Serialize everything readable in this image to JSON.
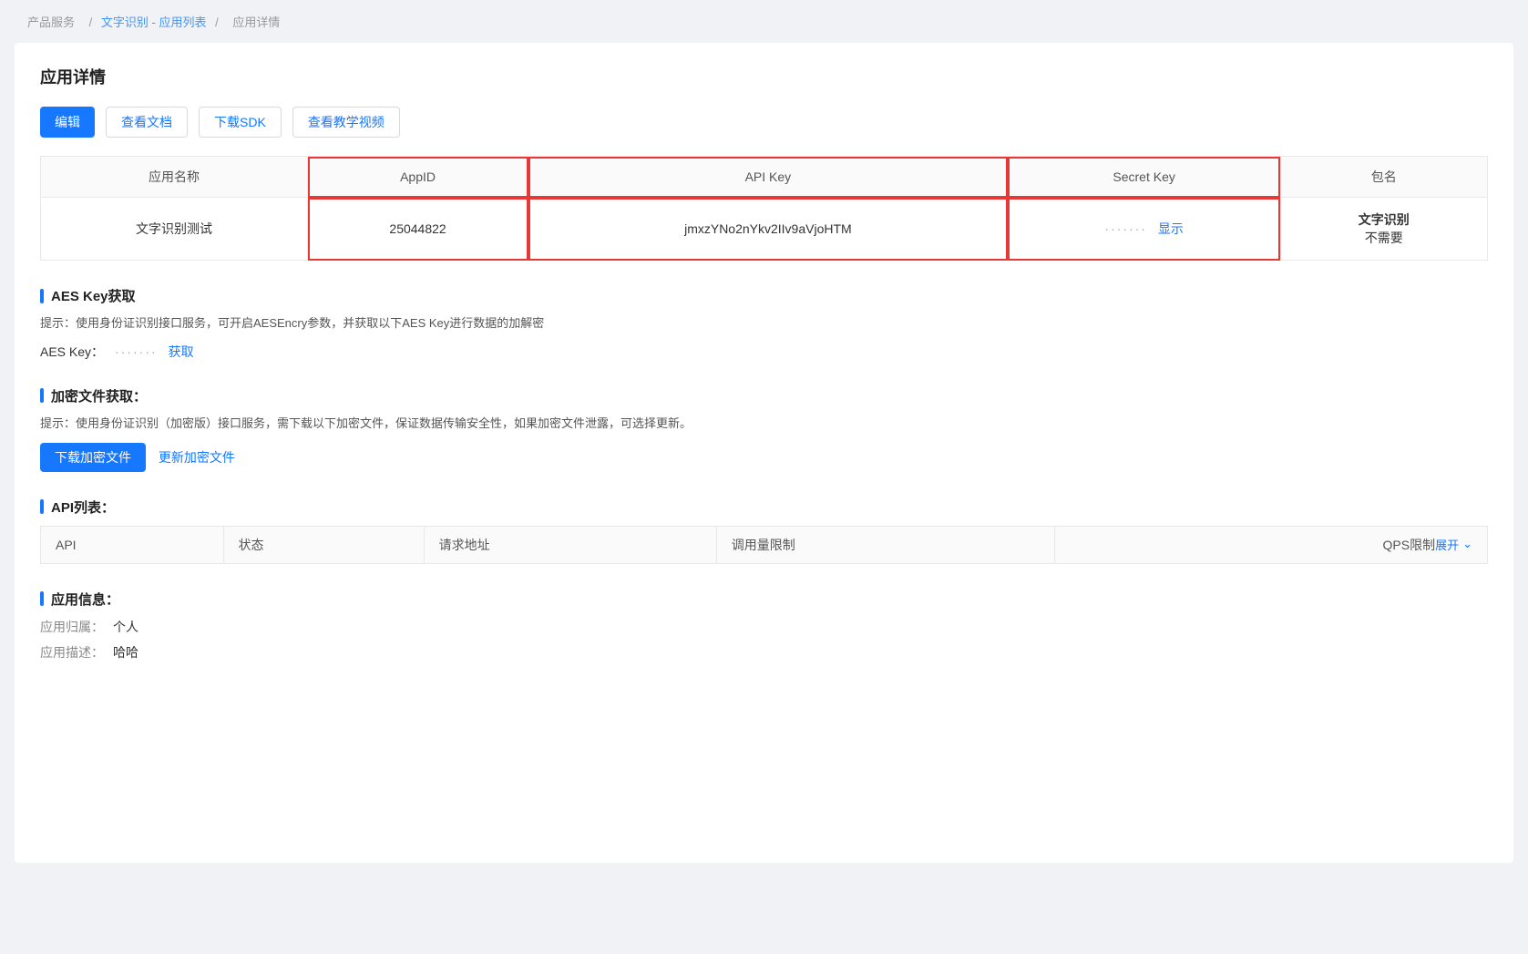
{
  "breadcrumb": {
    "root": "产品服务",
    "sep1": "/",
    "link1": "文字识别 - 应用列表",
    "sep2": "/",
    "current": "应用详情"
  },
  "page": {
    "title": "应用详情"
  },
  "toolbar": {
    "btn_edit": "编辑",
    "btn_docs": "查看文档",
    "btn_sdk": "下载SDK",
    "btn_video": "查看教学视频"
  },
  "app_table": {
    "headers": [
      "应用名称",
      "AppID",
      "API Key",
      "Secret Key",
      "包名"
    ],
    "row": {
      "app_name": "文字识别测试",
      "app_id": "25044822",
      "api_key": "jmxzYNo2nYkv2IIv9aVjoHTM",
      "secret_key_masked": "·······",
      "secret_key_show": "显示",
      "pkg_name_bold": "文字识别",
      "pkg_name_sub": "不需要"
    }
  },
  "aes_section": {
    "title": "AES Key获取",
    "hint": "提示：使用身份证识别接口服务，可开启AESEncry参数，并获取以下AES Key进行数据的加解密",
    "label": "AES Key：",
    "masked": "·······",
    "get_link": "获取"
  },
  "encrypt_section": {
    "title": "加密文件获取：",
    "hint": "提示：使用身份证识别（加密版）接口服务，需下载以下加密文件，保证数据传输安全性，如果加密文件泄露，可选择更新。",
    "btn_download": "下载加密文件",
    "btn_update": "更新加密文件"
  },
  "api_section": {
    "title": "API列表：",
    "headers": [
      "API",
      "状态",
      "请求地址",
      "调用量限制",
      "QPS限制"
    ],
    "expand_label": "展开"
  },
  "app_info_section": {
    "title": "应用信息：",
    "owner_label": "应用归属：",
    "owner_value": "个人",
    "desc_label": "应用描述：",
    "desc_value": "哈哈"
  }
}
